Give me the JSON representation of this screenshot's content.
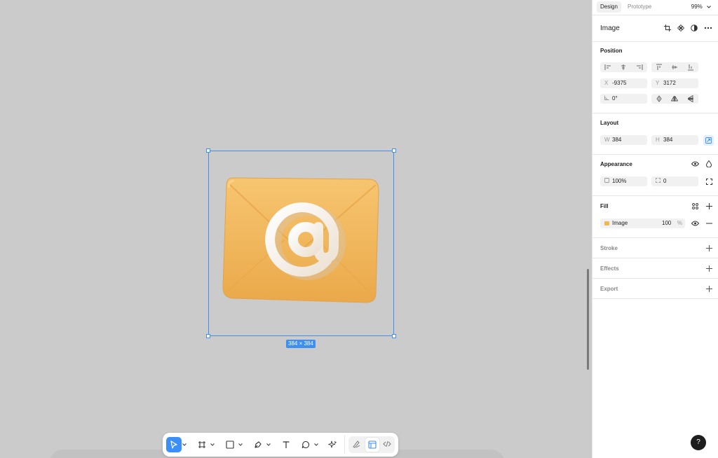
{
  "canvas": {
    "selection_size_label": "384 × 384",
    "image_name": "Envelope with at symbol",
    "colors": {
      "selection": "#3b8ff5",
      "envelope": "#f3b95a",
      "symbol": "#f6eee3"
    }
  },
  "toolbar": {
    "tools": [
      {
        "name": "move-tool",
        "icon": "cursor-icon",
        "active": true
      },
      {
        "name": "frame-tool",
        "icon": "frame-icon",
        "active": false
      },
      {
        "name": "shape-tool",
        "icon": "square-icon",
        "active": false
      },
      {
        "name": "pen-tool",
        "icon": "pen-icon",
        "active": false
      },
      {
        "name": "text-tool",
        "icon": "text-icon",
        "active": false
      },
      {
        "name": "comment-tool",
        "icon": "comment-icon",
        "active": false
      },
      {
        "name": "actions-tool",
        "icon": "sparkle-icon",
        "active": false
      }
    ],
    "modes": [
      "draw-mode",
      "design-mode",
      "dev-mode"
    ]
  },
  "panel": {
    "tabs": [
      "Design",
      "Prototype"
    ],
    "zoom": "99%",
    "layer_title": "Image",
    "position": {
      "title": "Position",
      "x_label": "X",
      "x_value": "-9375",
      "y_label": "Y",
      "y_value": "3172",
      "rotation": "0°"
    },
    "layout": {
      "title": "Layout",
      "w_label": "W",
      "w_value": "384",
      "h_label": "H",
      "h_value": "384"
    },
    "appearance": {
      "title": "Appearance",
      "opacity": "100%",
      "radius": "0"
    },
    "fill": {
      "title": "Fill",
      "type": "Image",
      "opacity": "100",
      "unit": "%"
    },
    "stroke": {
      "title": "Stroke"
    },
    "effects": {
      "title": "Effects"
    },
    "export": {
      "title": "Export"
    },
    "help": "?"
  }
}
